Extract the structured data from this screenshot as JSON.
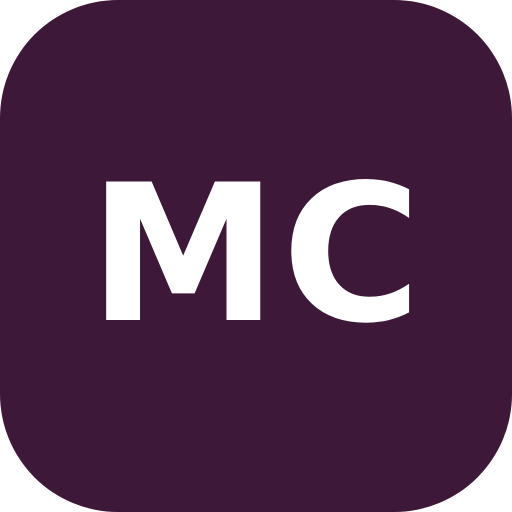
{
  "icon": {
    "monogram": "MC",
    "background_color": "#3d1838",
    "text_color": "#ffffff"
  }
}
